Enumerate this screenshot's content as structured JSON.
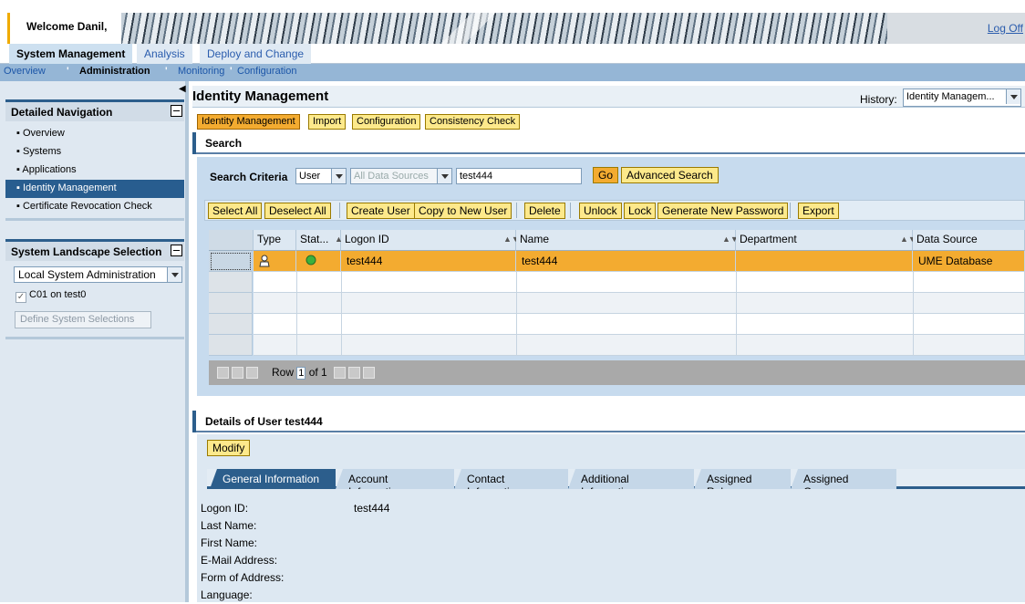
{
  "header": {
    "welcome": "Welcome Danil,",
    "logoff": "Log Off"
  },
  "topnav": {
    "level1": [
      "System Management",
      "Analysis",
      "Deploy and Change"
    ],
    "level2": [
      "Overview",
      "Administration",
      "Monitoring",
      "Configuration"
    ]
  },
  "sidebar": {
    "detailed_nav_title": "Detailed Navigation",
    "items": [
      "Overview",
      "Systems",
      "Applications",
      "Identity Management",
      "Certificate Revocation Check"
    ],
    "landscape_title": "System Landscape Selection",
    "landscape_value": "Local System Administration",
    "checkbox_label": "C01 on test0",
    "define_button": "Define System Selections"
  },
  "page": {
    "title": "Identity Management",
    "history_label": "History:",
    "history_value": "Identity Managem..."
  },
  "tabs": [
    "Identity Management",
    "Import",
    "Configuration",
    "Consistency Check"
  ],
  "search": {
    "section_title": "Search",
    "criteria_label": "Search Criteria",
    "criteria_type": "User",
    "data_source": "All Data Sources",
    "query": "test444",
    "go_label": "Go",
    "advanced_label": "Advanced Search"
  },
  "toolbar": [
    "Select All",
    "Deselect All",
    "Create User",
    "Copy to New User",
    "Delete",
    "Unlock",
    "Lock",
    "Generate New Password",
    "Export"
  ],
  "table": {
    "columns": [
      "Type",
      "Stat...",
      "Logon ID",
      "Name",
      "Department",
      "Data Source"
    ],
    "rows": [
      {
        "logon_id": "test444",
        "name": "test444",
        "department": "",
        "data_source": "UME Database"
      }
    ],
    "pager": {
      "row_label": "Row",
      "row_value": "1",
      "of_label": "of 1"
    }
  },
  "details": {
    "title": "Details of User test444",
    "modify_label": "Modify",
    "tabs": [
      "General Information",
      "Account Information",
      "Contact Information",
      "Additional Information",
      "Assigned Roles",
      "Assigned Groups"
    ],
    "fields": [
      "Logon ID:",
      "Last Name:",
      "First Name:",
      "E-Mail Address:",
      "Form of Address:",
      "Language:"
    ],
    "logon_id_value": "test444"
  },
  "colors": {
    "accent": "#2c5e8c",
    "selected_row": "#f3ab30",
    "button_yellow": "#fde98b"
  }
}
